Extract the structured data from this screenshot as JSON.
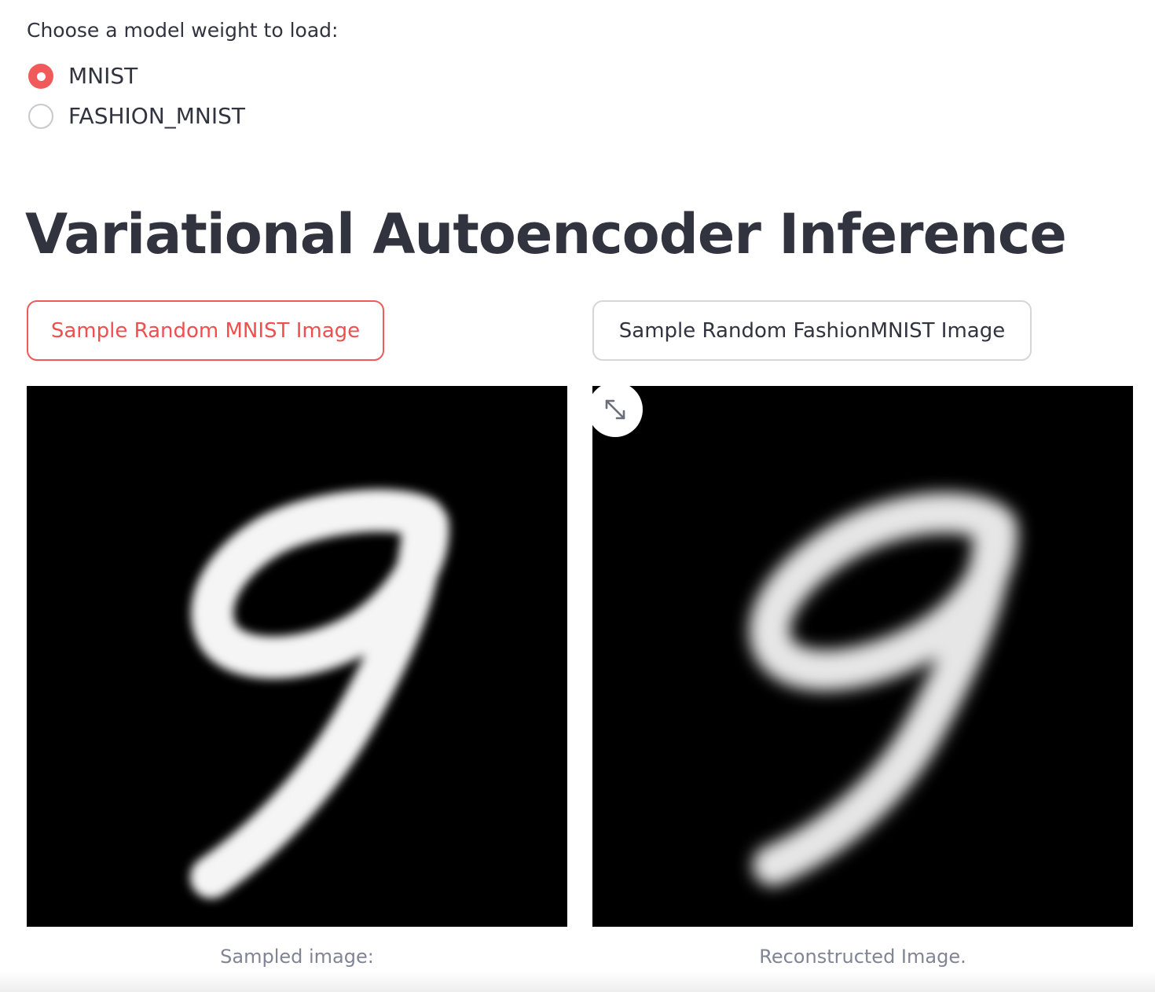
{
  "model_selector": {
    "label": "Choose a model weight to load:",
    "options": [
      {
        "label": "MNIST",
        "selected": true
      },
      {
        "label": "FASHION_MNIST",
        "selected": false
      }
    ]
  },
  "main": {
    "title": "Variational Autoencoder Inference",
    "buttons": {
      "sample_mnist": "Sample Random MNIST Image",
      "sample_fashion": "Sample Random FashionMNIST Image"
    },
    "images": {
      "sampled": {
        "caption": "Sampled image:",
        "content": "handwritten digit 9"
      },
      "reconstructed": {
        "caption": "Reconstructed Image.",
        "content": "handwritten digit 9 (reconstruction)"
      }
    }
  },
  "icons": {
    "fullscreen": "expand-arrows-icon"
  },
  "colors": {
    "accent": "#f05a5a",
    "text": "#31333f",
    "caption": "#808495",
    "border": "#d6d6da"
  }
}
